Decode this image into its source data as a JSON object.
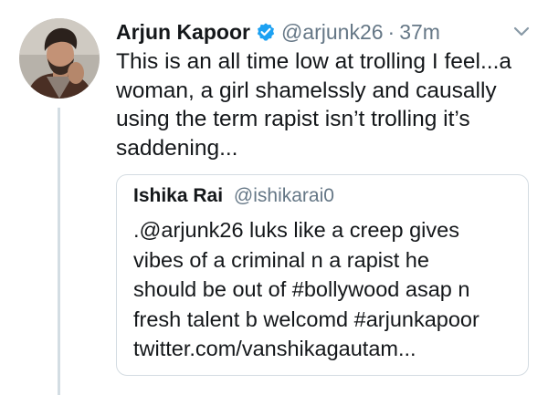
{
  "tweet": {
    "author_name": "Arjun Kapoor",
    "handle": "@arjunk26",
    "separator": "·",
    "time": "37m",
    "verified_icon": "verified-badge-icon",
    "text_lines": [
      "This is an all time low at trolling I feel...a",
      "woman, a girl shamelssly and causally",
      "using the term rapist isn’t trolling it’s",
      "saddening..."
    ]
  },
  "quoted_tweet": {
    "author_name": "Ishika Rai",
    "handle": "@ishikarai0",
    "text_lines": [
      ".@arjunk26 luks like a creep gives",
      "vibes of a criminal n a rapist he",
      "should be out of #bollywood asap n",
      "fresh talent b welcomd #arjunkapoor",
      "twitter.com/vanshikagautam..."
    ]
  },
  "colors": {
    "verified_blue": "#1da1f2",
    "secondary_text": "#657786",
    "primary_text": "#14171a",
    "border": "#d4dce2"
  }
}
